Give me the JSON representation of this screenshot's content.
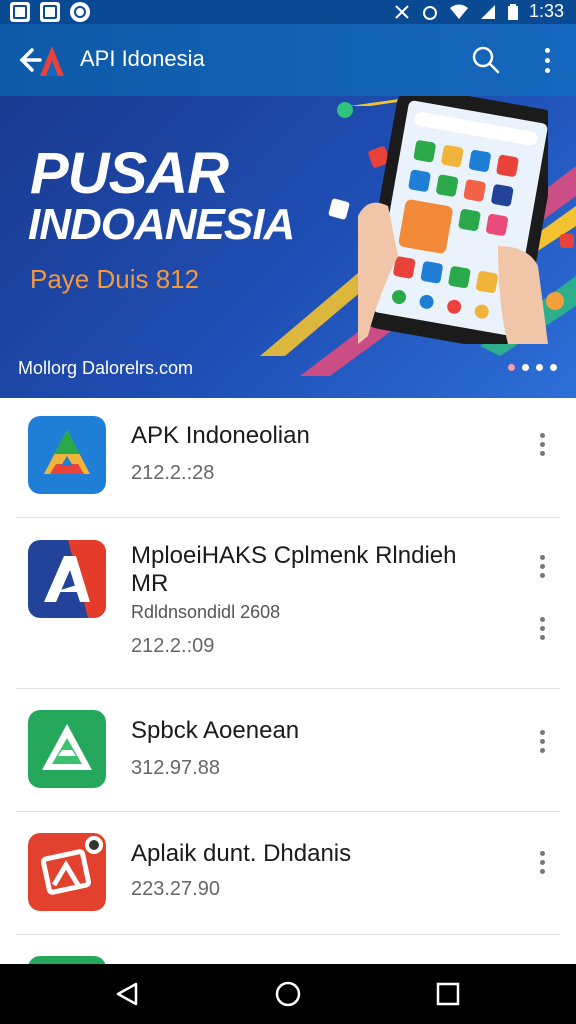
{
  "status_bar": {
    "time": "1:33",
    "icons_left": [
      "gallery-icon",
      "image-icon",
      "sync-icon"
    ],
    "icons_right": [
      "mute-icon",
      "alarm-icon",
      "wifi-icon",
      "signal-icon",
      "battery-icon"
    ]
  },
  "app_bar": {
    "title": "API Idonesia",
    "search_icon": "search-icon",
    "menu_icon": "more-vert-icon"
  },
  "banner": {
    "heading_line1": "PUSAR",
    "heading_line2": "INDOANESIA",
    "subheading": "Paye Duis 812",
    "url": "Mollorg Dalorelrs.com",
    "pages": 4,
    "active_page": 0
  },
  "apps": [
    {
      "name": "APK Indoneolian",
      "subtitle": "",
      "version": "212.2.:28",
      "colors": [
        "#1f7ed6",
        "#2aa84a",
        "#f0b43a"
      ]
    },
    {
      "name": "MploeiHAKS Cplmenk Rlndieh MR",
      "subtitle": "Rdldnsondidl 2608",
      "version": "212.2.:09",
      "colors": [
        "#23439a",
        "#e43b2b"
      ]
    },
    {
      "name": "Spbck Aoenean",
      "subtitle": "",
      "version": "312.97.88",
      "colors": [
        "#25a85b",
        "#3dc270"
      ]
    },
    {
      "name": "Aplaik dunt. Dhdanis",
      "subtitle": "",
      "version": "223.27.90",
      "colors": [
        "#e2412e",
        "#f26247"
      ]
    }
  ],
  "colors": {
    "primary": "#1567bd",
    "status_bar": "#0a4a93",
    "accent": "#f49a3c"
  }
}
